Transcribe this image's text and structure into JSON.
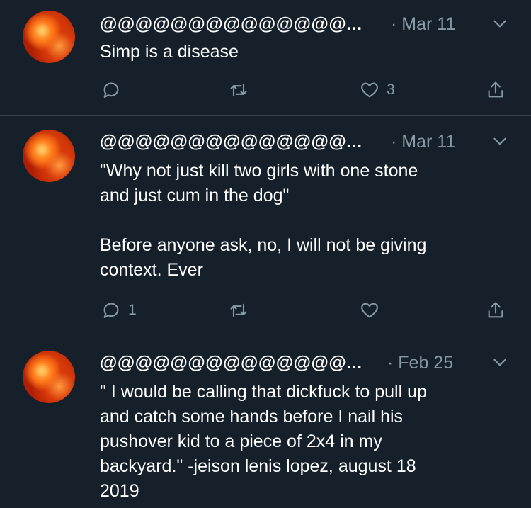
{
  "tweets": [
    {
      "handle": "@@@@@@@@@@@@@@...",
      "date": "· Mar 11",
      "text": "Simp is a disease",
      "reply_count": "",
      "like_count": "3"
    },
    {
      "handle": "@@@@@@@@@@@@@@...",
      "date": "· Mar 11",
      "text": "\"Why not just kill two girls with one stone\nand just cum in the dog\"\n\nBefore anyone ask, no, I will not be giving\ncontext. Ever",
      "reply_count": "1",
      "like_count": ""
    },
    {
      "handle": "@@@@@@@@@@@@@@...",
      "date": "· Feb 25",
      "text": "\" I would be calling that dickfuck to pull up\nand catch some hands before I nail his\npushover kid to a piece of 2x4 in my\nbackyard.\" -jeison lenis lopez, august 18\n2019",
      "reply_count": "",
      "like_count": ""
    }
  ],
  "icons": {
    "reply": "reply-icon",
    "retweet": "retweet-icon",
    "like": "heart-icon",
    "share": "share-icon",
    "menu": "chevron-down-icon"
  },
  "colors": {
    "background": "#15202b",
    "secondary_text": "#8899a6",
    "divider": "#38444d"
  }
}
